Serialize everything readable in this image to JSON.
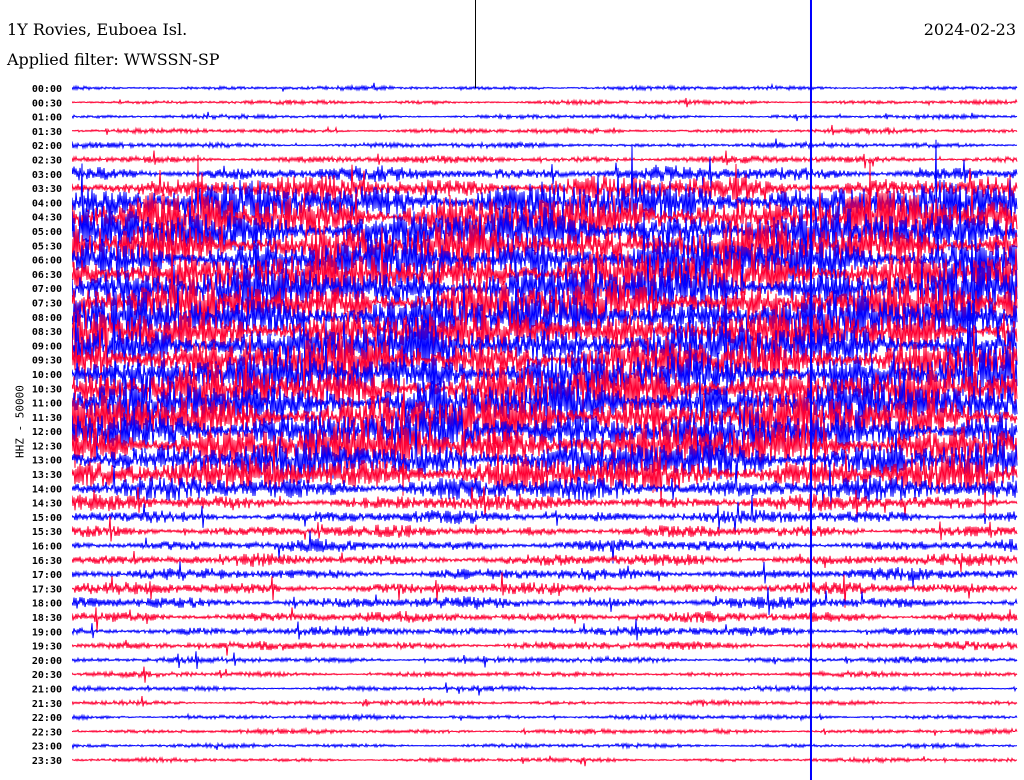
{
  "header": {
    "station": "1Y Rovies, Euboea Isl.",
    "filter": "Applied filter: WWSSN-SP",
    "date": "2024-02-23"
  },
  "chart_data": {
    "type": "line",
    "title": "1Y Rovies, Euboea Isl.",
    "ylabel": "HHZ - 50000",
    "xlabel": "",
    "row_labels": [
      "00:00",
      "00:30",
      "01:00",
      "01:30",
      "02:00",
      "02:30",
      "03:00",
      "03:30",
      "04:00",
      "04:30",
      "05:00",
      "05:30",
      "06:00",
      "06:30",
      "07:00",
      "07:30",
      "08:00",
      "08:30",
      "09:00",
      "09:30",
      "10:00",
      "10:30",
      "11:00",
      "11:30",
      "12:00",
      "12:30",
      "13:00",
      "13:30",
      "14:00",
      "14:30",
      "15:00",
      "15:30",
      "16:00",
      "16:30",
      "17:00",
      "17:30",
      "18:00",
      "18:30",
      "19:00",
      "19:30",
      "20:00",
      "20:30",
      "21:00",
      "21:30",
      "22:00",
      "22:30",
      "23:00",
      "23:30"
    ],
    "row_colors": [
      "#0000ff",
      "#ff0033"
    ],
    "relative_amplitude": [
      0.35,
      0.35,
      0.35,
      0.4,
      0.45,
      0.6,
      1.2,
      2,
      3.5,
      4,
      4,
      4,
      4,
      4,
      4,
      4,
      4,
      4,
      4,
      4,
      4,
      4,
      4,
      4,
      4,
      4,
      3.5,
      3,
      2,
      1.3,
      1.1,
      1,
      1,
      1,
      1,
      1,
      1,
      0.9,
      0.8,
      0.7,
      0.5,
      0.45,
      0.4,
      0.4,
      0.4,
      0.4,
      0.35,
      0.35
    ],
    "markers": [
      {
        "color": "#0000ff",
        "row_fraction": 0.782
      },
      {
        "color": "#000000",
        "row_fraction": 0.427
      }
    ]
  }
}
